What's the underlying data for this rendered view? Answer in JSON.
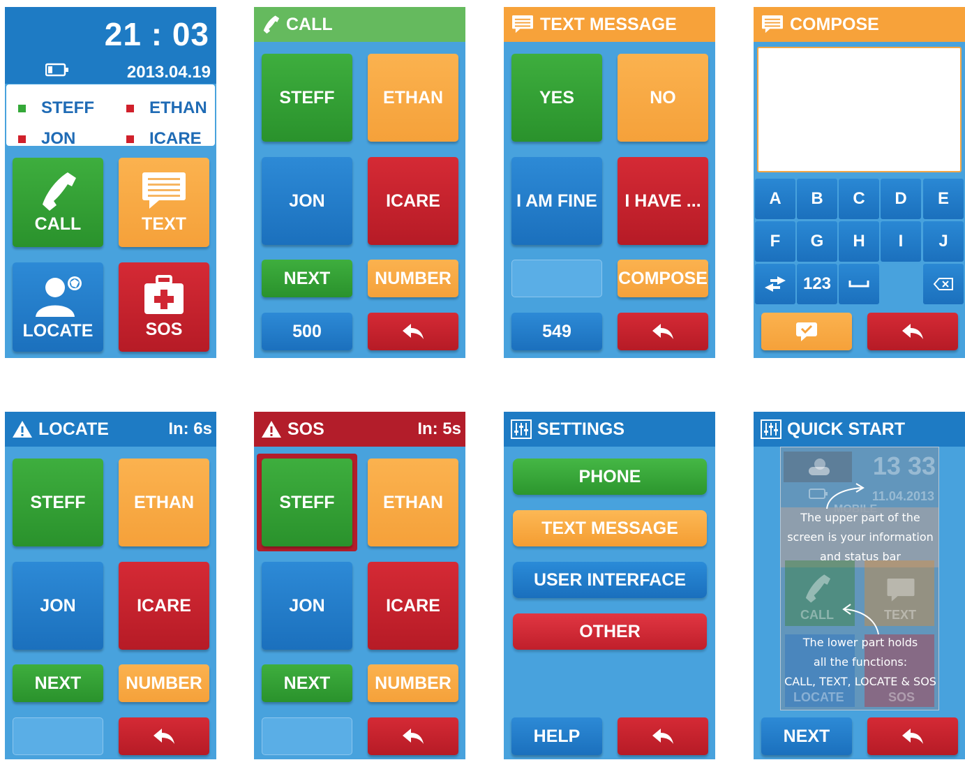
{
  "home": {
    "time": "21 : 03",
    "date": "2013.04.19",
    "contacts": [
      {
        "name": "STEFF",
        "status": "green"
      },
      {
        "name": "ETHAN",
        "status": "red"
      },
      {
        "name": "JON",
        "status": "red"
      },
      {
        "name": "ICARE",
        "status": "red"
      }
    ],
    "tiles": {
      "call": "CALL",
      "text": "TEXT",
      "locate": "LOCATE",
      "sos": "SOS"
    }
  },
  "call": {
    "title": "CALL",
    "contacts": [
      "STEFF",
      "ETHAN",
      "JON",
      "ICARE"
    ],
    "next": "NEXT",
    "number": "NUMBER",
    "count": "500"
  },
  "text_message": {
    "title": "TEXT MESSAGE",
    "replies": [
      "YES",
      "NO",
      "I AM FINE",
      "I HAVE ..."
    ],
    "compose": "COMPOSE",
    "count": "549"
  },
  "compose": {
    "title": "COMPOSE",
    "keys_row1": [
      "A",
      "B",
      "C",
      "D",
      "E"
    ],
    "keys_row2": [
      "F",
      "G",
      "H",
      "I",
      "J"
    ],
    "num_key": "123"
  },
  "locate": {
    "title": "LOCATE",
    "timer": "In: 6s",
    "contacts": [
      "STEFF",
      "ETHAN",
      "JON",
      "ICARE"
    ],
    "next": "NEXT",
    "number": "NUMBER"
  },
  "sos": {
    "title": "SOS",
    "timer": "In: 5s",
    "contacts": [
      "STEFF",
      "ETHAN",
      "JON",
      "ICARE"
    ],
    "next": "NEXT",
    "number": "NUMBER"
  },
  "settings": {
    "title": "SETTINGS",
    "options": [
      "PHONE",
      "TEXT MESSAGE",
      "USER INTERFACE",
      "OTHER"
    ],
    "help": "HELP"
  },
  "quick_start": {
    "title": "QUICK START",
    "ghost_time": "13  33",
    "ghost_date": "11.04.2013",
    "ghost_name": "MOBILE",
    "ghost_tiles": [
      "CALL",
      "TEXT",
      "LOCATE",
      "SOS"
    ],
    "note_upper": "The upper part of the screen is your information and status bar",
    "note_lower_1": "The lower part holds",
    "note_lower_2": "all the functions:",
    "note_lower_3": "CALL, TEXT, LOCATE & SOS",
    "next": "NEXT"
  },
  "colors": {
    "blue_bg": "#48a2dd",
    "header_blue": "#1e7bc4",
    "green": "#34a838",
    "orange": "#f7a23a",
    "red": "#c01f2b"
  }
}
